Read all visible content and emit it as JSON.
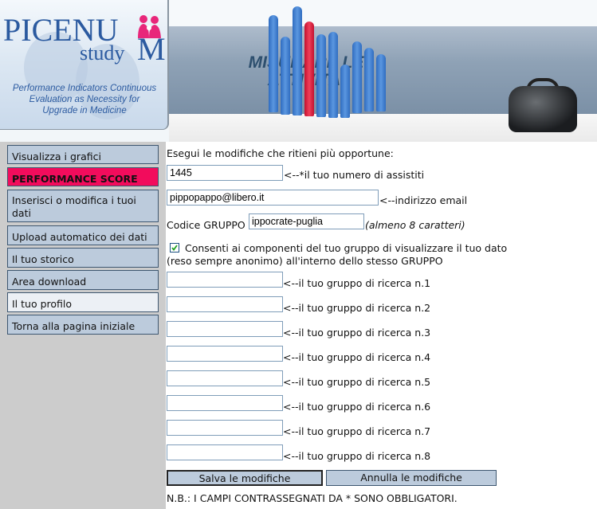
{
  "header": {
    "logo": {
      "title": "PICENU",
      "subtitle": "study",
      "m_letter": "M",
      "tagline_lines": [
        "Performance Indicators Continuous",
        "Evaluation as Necessity for",
        "Upgrade  in Medicine"
      ]
    },
    "banner": {
      "title_lines": [
        "MISURARE LE",
        "ATTIVITA'"
      ]
    }
  },
  "sidebar": {
    "items": [
      {
        "label": "Visualizza i grafici",
        "state": "normal"
      },
      {
        "label": "PERFORMANCE SCORE",
        "state": "highlight"
      },
      {
        "label": "Inserisci o modifica i tuoi dati",
        "state": "normal"
      },
      {
        "label": "Upload automatico dei dati",
        "state": "normal"
      },
      {
        "label": "Il tuo storico",
        "state": "normal"
      },
      {
        "label": "Area download",
        "state": "normal"
      },
      {
        "label": "Il tuo profilo",
        "state": "current"
      },
      {
        "label": "Torna alla pagina iniziale",
        "state": "normal"
      }
    ]
  },
  "form": {
    "intro": "Esegui le modifiche che ritieni più opportune:",
    "assistiti": {
      "value": "1445",
      "label": "<--*il tuo numero di assistiti"
    },
    "email": {
      "value": "pippopappo@libero.it",
      "label": "<--indirizzo email"
    },
    "gruppo": {
      "label": "Codice GRUPPO",
      "value": "ippocrate-puglia",
      "hint": "(almeno 8 caratteri)"
    },
    "consent": {
      "checked": true,
      "line1": "Consenti ai componenti del tuo gruppo di visualizzare il tuo dato",
      "line2": "(reso sempre anonimo) all'interno dello stesso GRUPPO"
    },
    "research_groups": [
      {
        "value": "",
        "label": "<--il tuo gruppo di ricerca n.1"
      },
      {
        "value": "",
        "label": "<--il tuo gruppo di ricerca n.2"
      },
      {
        "value": "",
        "label": "<--il tuo gruppo di ricerca n.3"
      },
      {
        "value": "",
        "label": "<--il tuo gruppo di ricerca n.4"
      },
      {
        "value": "",
        "label": "<--il tuo gruppo di ricerca n.5"
      },
      {
        "value": "",
        "label": "<--il tuo gruppo di ricerca n.6"
      },
      {
        "value": "",
        "label": "<--il tuo gruppo di ricerca n.7"
      },
      {
        "value": "",
        "label": "<--il tuo gruppo di ricerca n.8"
      }
    ],
    "save_label": "Salva le modifiche",
    "cancel_label": "Annulla le modifiche",
    "note": "N.B.: I CAMPI CONTRASSEGNATI DA * SONO OBBLIGATORI."
  },
  "colors": {
    "nav_bg": "#bccbdc",
    "nav_highlight": "#f20c5c",
    "nav_current": "#ecf0f5",
    "sidebar_bg": "#cccccc",
    "brand_blue": "#2b5aa0"
  }
}
